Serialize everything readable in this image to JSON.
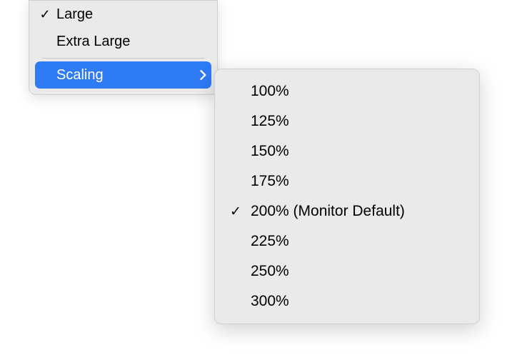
{
  "primary_menu": {
    "items": [
      {
        "label": "Large",
        "checked": true
      },
      {
        "label": "Extra Large",
        "checked": false
      }
    ],
    "submenu_trigger": {
      "label": "Scaling"
    }
  },
  "scaling_submenu": {
    "items": [
      {
        "label": "100%",
        "checked": false
      },
      {
        "label": "125%",
        "checked": false
      },
      {
        "label": "150%",
        "checked": false
      },
      {
        "label": "175%",
        "checked": false
      },
      {
        "label": "200% (Monitor Default)",
        "checked": true
      },
      {
        "label": "225%",
        "checked": false
      },
      {
        "label": "250%",
        "checked": false
      },
      {
        "label": "300%",
        "checked": false
      }
    ]
  }
}
